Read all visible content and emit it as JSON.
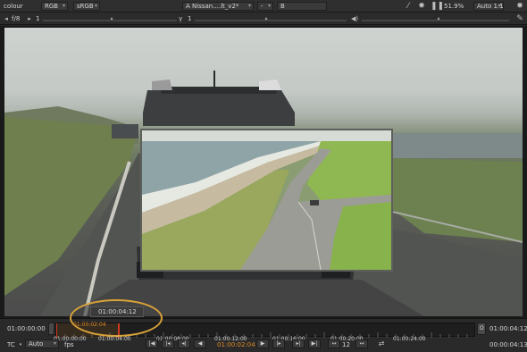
{
  "toolbar": {
    "channel": "colour",
    "colorspace": "RGB",
    "lut": "sRGB",
    "input_a": "A  Nissan....lt_v2*",
    "wipe": "-",
    "input_b": "B",
    "zoom": "51.9%",
    "proxy": "Auto 1:1",
    "fstop_label": "f/8",
    "gain_value": "1",
    "gamma_label": "γ",
    "gamma_value": "1"
  },
  "timeline": {
    "in_point": "01:00:00:00",
    "out_point": "01:00:04:12",
    "hover_timecode": "01:00:04:12",
    "current_marker": "01:00:02:04",
    "ticks": [
      "01:00:00:00",
      "01:00:04:00",
      "01:00:08:00",
      "01:00:12:00",
      "01:00:16:00",
      "01:00:20:00",
      "01:00:24:00"
    ],
    "current_timecode": "01:00:02:04",
    "frame_increment": "12",
    "end_timecode": "00:00:04:13",
    "tc_label": "TC",
    "fps_mode": "Auto",
    "fps_label": "fps",
    "o_label": "O"
  },
  "colors": {
    "accent": "#e08b2a",
    "playhead": "#d23a1f",
    "panel": "#2a2a2a"
  }
}
